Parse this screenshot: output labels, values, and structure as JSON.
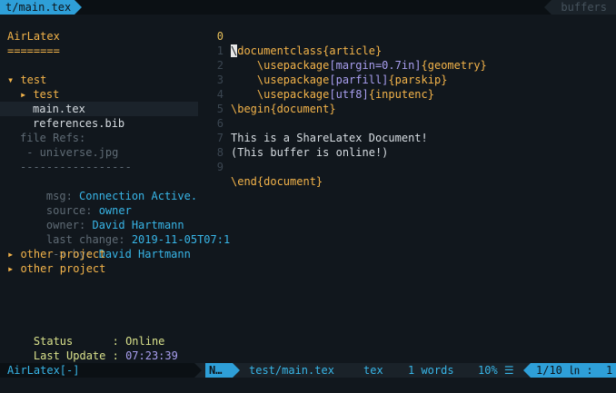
{
  "tabline": {
    "active_tab": "t/main.tex",
    "buffers_label": "buffers"
  },
  "sidebar": {
    "title": "AirLatex",
    "underline": "========",
    "project_open": "▾ test",
    "folder": "▸ test",
    "files": [
      "main.tex",
      "references.bib"
    ],
    "file_refs_label": "file Refs:",
    "file_ref": " - universe.jpg",
    "separator": "-----------------",
    "msg_label": "msg: ",
    "msg_value": "Connection Active.",
    "source_label": "source: ",
    "source_value": "owner",
    "owner_label": "owner: ",
    "owner_value": "David Hartmann",
    "last_change_label": "last change: ",
    "last_change_value": "2019-11-05T07:1",
    "by_label": " -> by: ",
    "by_value": "David Hartmann",
    "other_projects": [
      "▸ other project",
      "▸ other project"
    ],
    "status_label": "Status      : ",
    "status_value": "Online",
    "last_update_label": "Last Update : ",
    "last_update_value": "07:23:39"
  },
  "editor": {
    "line_numbers": [
      "0",
      "1",
      "2",
      "3",
      "4",
      "5",
      "6",
      "7",
      "8",
      "9"
    ],
    "lines": {
      "l0_cursor": "\\",
      "l0_cmd": "documentclass",
      "l0_arg": "{article}",
      "l1_cmd": "    \\usepackage",
      "l1_opt": "[margin=0.7in]",
      "l1_arg": "{geometry}",
      "l2_cmd": "    \\usepackage",
      "l2_opt": "[parfill]",
      "l2_arg": "{parskip}",
      "l3_cmd": "    \\usepackage",
      "l3_opt": "[utf8]",
      "l3_arg": "{inputenc}",
      "l4": "\\begin{document}",
      "l5": "",
      "l6": "This is a ShareLatex Document!",
      "l7": "(This buffer is online!)",
      "l8": "",
      "l9": "\\end{document}"
    }
  },
  "statusbar": {
    "left": "AirLatex[-]",
    "mode": "N…",
    "file": "test/main.tex",
    "filetype": "tex",
    "words": "1 words",
    "percent": "10% ☰",
    "position": "1/10 ㏑ :  1"
  },
  "colors": {
    "accent": "#2e9fd8",
    "orange": "#f4b44a",
    "purple": "#a99ff0",
    "background": "#11171d"
  }
}
